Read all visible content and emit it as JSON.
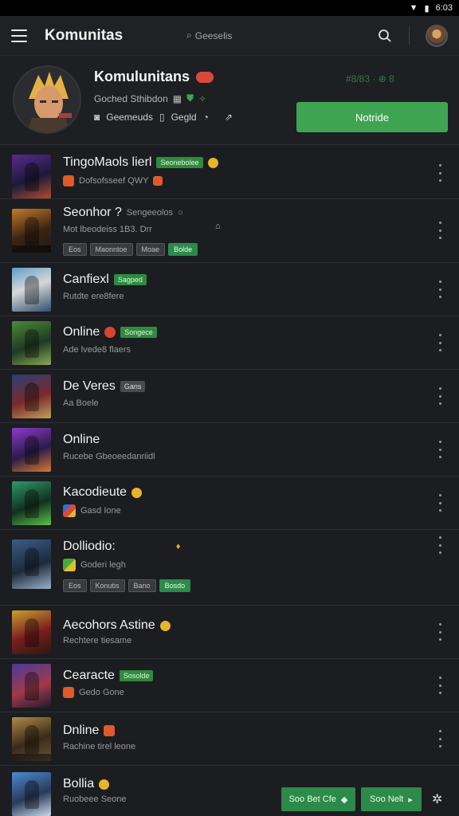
{
  "status_bar": {
    "time": "6:03"
  },
  "app_bar": {
    "title": "Komunitas",
    "search_hint": "Geeselis"
  },
  "profile": {
    "name": "Komulunitans",
    "subtitle": "Goched Sthibdon",
    "meta_1": "Geemeuds",
    "meta_2": "Gegld",
    "stat": "#8/83 · ⊕ 8",
    "follow_label": "Notride"
  },
  "items": [
    {
      "title": "TingoMaols lierl",
      "badge": "Seonebolee",
      "sub": "Dofsofsseef QWY",
      "style": "badge-green",
      "art": "art1",
      "icon": "icon-orange"
    },
    {
      "title": "Seonhor ?",
      "title_extra": "Sengeeolos",
      "sub": "Mot lbeodeiss 1B3. Drr",
      "tags": [
        "Eos",
        "Maonntoe",
        "Moae"
      ],
      "tag_green": "Bolde",
      "art": "art2"
    },
    {
      "title": "Canfiexl",
      "badge": "Sagped",
      "sub": "Rutdte ere8fere",
      "style": "badge-green",
      "art": "art3"
    },
    {
      "title": "Online",
      "badge": "Songece",
      "sub": "Ade lvede8 flaers",
      "style": "badge-green",
      "art": "art4",
      "icon": "icon-red"
    },
    {
      "title": "De Veres",
      "badge": "Gans",
      "sub": "Aa Boele",
      "style": "badge-gray",
      "art": "art5"
    },
    {
      "title": "Online",
      "sub": "Rucebe Gbeoeedanriidl",
      "art": "art6"
    },
    {
      "title": "Kacodieute",
      "sub": "Gasd Ione",
      "art": "art7",
      "icon": "icon-yellow",
      "sub_icon": "icon-multi"
    },
    {
      "title": "Dolliodio:",
      "sub": "Goderi legh",
      "tags": [
        "Eos",
        "Konutis",
        "Bano"
      ],
      "tag_green": "Bosdo",
      "art": "art8",
      "sub_icon": "icon-green-multi"
    },
    {
      "title": "Aecohors Astine",
      "sub": "Rechtere tiesame",
      "art": "art9",
      "icon": "icon-yellow"
    },
    {
      "title": "Cearacte",
      "badge": "Sosolde",
      "sub": "Gedo Gone",
      "style": "badge-green",
      "art": "art10",
      "sub_icon": "icon-orange"
    },
    {
      "title": "Dnline",
      "sub": "Rachine tirel leone",
      "art": "art11",
      "icon": "icon-orange"
    },
    {
      "title": "Bollia",
      "sub": "Ruobeee Seone",
      "art": "art12",
      "icon": "icon-yellow"
    }
  ],
  "footer": {
    "button_1": "Soo Bet Cfe",
    "button_2": "Soo Nelt"
  }
}
